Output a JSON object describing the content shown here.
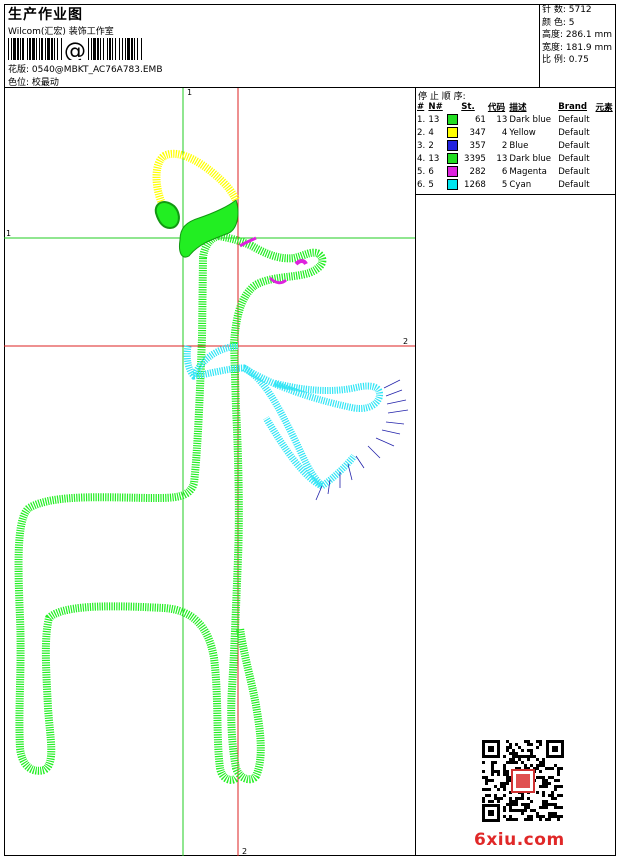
{
  "header": {
    "title": "生产作业图",
    "studio": "Wilcom(汇宏) 装饰工作室",
    "design": "花版: 0540@MBKT_AC76A783.EMB",
    "position": "色位: 校最动"
  },
  "specs": [
    {
      "label": "针 数: 5712"
    },
    {
      "label": "颜 色: 5"
    },
    {
      "label": "高度: 286.1 mm"
    },
    {
      "label": "宽度: 181.9 mm"
    },
    {
      "label": "比 例: 0.75"
    }
  ],
  "stop_sequence": {
    "title": "停 止 顺 序:",
    "headers": [
      "#",
      "N#",
      "St.",
      "代码",
      "描述",
      "Brand",
      "元素"
    ],
    "rows": [
      {
        "idx": "1.",
        "needle": "13",
        "color": "#22dd22",
        "stitches": "61",
        "code": "13",
        "desc": "Dark blue",
        "brand": "Default"
      },
      {
        "idx": "2.",
        "needle": "4",
        "color": "#ffff00",
        "stitches": "347",
        "code": "4",
        "desc": "Yellow",
        "brand": "Default"
      },
      {
        "idx": "3.",
        "needle": "2",
        "color": "#2222dd",
        "stitches": "357",
        "code": "2",
        "desc": "Blue",
        "brand": "Default"
      },
      {
        "idx": "4.",
        "needle": "13",
        "color": "#22dd22",
        "stitches": "3395",
        "code": "13",
        "desc": "Dark blue",
        "brand": "Default"
      },
      {
        "idx": "5.",
        "needle": "6",
        "color": "#dd22dd",
        "stitches": "282",
        "code": "6",
        "desc": "Magenta",
        "brand": "Default"
      },
      {
        "idx": "6.",
        "needle": "5",
        "color": "#00e5ee",
        "stitches": "1268",
        "code": "5",
        "desc": "Cyan",
        "brand": "Default"
      }
    ]
  },
  "axes": {
    "v1_top": "1",
    "h1_left": "1",
    "h2_right": "2",
    "v2_bottom": "2"
  },
  "watermark": "6xiu.com",
  "colors": {
    "green": "#22ee22",
    "yellow": "#ffff00",
    "cyan": "#33e5f5",
    "magenta": "#dd22dd",
    "blue": "#2222aa",
    "guide_green": "#22cc22",
    "guide_red": "#dd2222"
  }
}
